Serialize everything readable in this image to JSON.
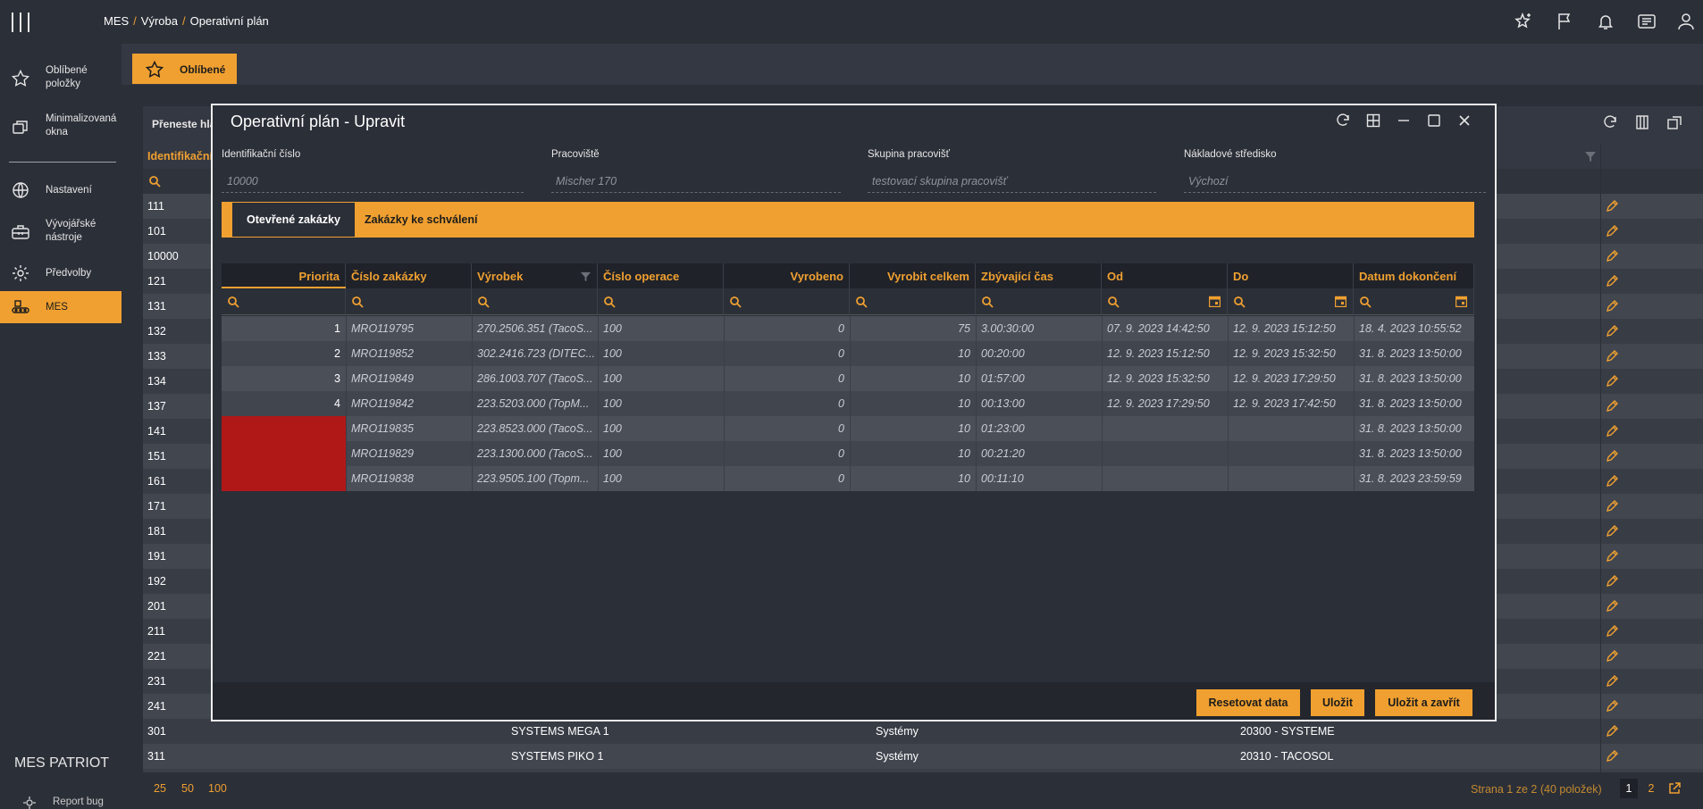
{
  "breadcrumb": {
    "part1": "MES",
    "part2": "Výroba",
    "part3": "Operativní plán"
  },
  "sidebar": {
    "items": [
      {
        "label": "Oblíbené položky",
        "icon": "star-icon"
      },
      {
        "label": "Minimalizovaná okna",
        "icon": "windows-icon"
      },
      {
        "label": "Nastavení",
        "icon": "globe-icon"
      },
      {
        "label": "Vývojářské nástroje",
        "icon": "toolbox-icon"
      },
      {
        "label": "Předvolby",
        "icon": "gear-icon"
      },
      {
        "label": "MES",
        "icon": "conveyor-icon"
      }
    ],
    "brand": "MES PATRIOT",
    "report_bug": "Report bug"
  },
  "favorites": {
    "label": "Oblíbené"
  },
  "background": {
    "toolbar_text": "Přeneste hla",
    "header_text": "Identifikační",
    "rows": [
      [
        "111",
        "",
        "",
        ""
      ],
      [
        "101",
        "",
        "",
        ""
      ],
      [
        "10000",
        "",
        "",
        ""
      ],
      [
        "121",
        "",
        "",
        ""
      ],
      [
        "131",
        "",
        "",
        ""
      ],
      [
        "132",
        "",
        "",
        ""
      ],
      [
        "133",
        "",
        "",
        ""
      ],
      [
        "134",
        "",
        "",
        ""
      ],
      [
        "137",
        "",
        "",
        ""
      ],
      [
        "141",
        "",
        "",
        ""
      ],
      [
        "151",
        "",
        "",
        ""
      ],
      [
        "161",
        "",
        "",
        ""
      ],
      [
        "171",
        "",
        "",
        ""
      ],
      [
        "181",
        "",
        "",
        ""
      ],
      [
        "191",
        "",
        "",
        ""
      ],
      [
        "192",
        "",
        "",
        ""
      ],
      [
        "201",
        "",
        "",
        ""
      ],
      [
        "211",
        "",
        "",
        ""
      ],
      [
        "221",
        "",
        "",
        ""
      ],
      [
        "231",
        "",
        "",
        ""
      ],
      [
        "241",
        "",
        "",
        ""
      ],
      [
        "301",
        "SYSTEMS MEGA 1",
        "Systémy",
        "20300 - SYSTEME"
      ],
      [
        "311",
        "SYSTEMS PIKO 1",
        "Systémy",
        "20310 - TACOSOL"
      ]
    ],
    "page_sizes": [
      "25",
      "50",
      "100"
    ],
    "page_info": "Strana 1 ze 2 (40 položek)",
    "pages": [
      "1",
      "2"
    ]
  },
  "modal": {
    "title": "Operativní plán - Upravit",
    "fields": [
      {
        "label": "Identifikační číslo",
        "value": "10000"
      },
      {
        "label": "Pracoviště",
        "value": "Mischer 170"
      },
      {
        "label": "Skupina pracovišť",
        "value": "testovací skupina pracovišť"
      },
      {
        "label": "Nákladové středisko",
        "value": "Výchozí"
      }
    ],
    "tabs": [
      "Otevřené zakázky",
      "Zakázky ke schválení"
    ],
    "columns": [
      "Priorita",
      "Číslo zakázky",
      "Výrobek",
      "Číslo operace",
      "Vyrobeno",
      "Vyrobit celkem",
      "Zbývající čas",
      "Od",
      "Do",
      "Datum dokončení"
    ],
    "rows": [
      [
        "1",
        "MRO119795",
        "270.2506.351 (TacoS...",
        "100",
        "0",
        "75",
        "3.00:30:00",
        "07. 9. 2023 14:42:50",
        "12. 9. 2023 15:12:50",
        "18. 4. 2023 10:55:52"
      ],
      [
        "2",
        "MRO119852",
        "302.2416.723 (DITEC...",
        "100",
        "0",
        "10",
        "00:20:00",
        "12. 9. 2023 15:12:50",
        "12. 9. 2023 15:32:50",
        "31. 8. 2023 13:50:00"
      ],
      [
        "3",
        "MRO119849",
        "286.1003.707 (TacoS...",
        "100",
        "0",
        "10",
        "01:57:00",
        "12. 9. 2023 15:32:50",
        "12. 9. 2023 17:29:50",
        "31. 8. 2023 13:50:00"
      ],
      [
        "4",
        "MRO119842",
        "223.5203.000 (TopM...",
        "100",
        "0",
        "10",
        "00:13:00",
        "12. 9. 2023 17:29:50",
        "12. 9. 2023 17:42:50",
        "31. 8. 2023 13:50:00"
      ],
      [
        "",
        "MRO119835",
        "223.8523.000 (TacoS...",
        "100",
        "0",
        "10",
        "01:23:00",
        "",
        "",
        "31. 8. 2023 13:50:00"
      ],
      [
        "",
        "MRO119829",
        "223.1300.000 (TacoS...",
        "100",
        "0",
        "10",
        "00:21:20",
        "",
        "",
        "31. 8. 2023 13:50:00"
      ],
      [
        "",
        "MRO119838",
        "223.9505.100 (Topm...",
        "100",
        "0",
        "10",
        "00:11:10",
        "",
        "",
        "31. 8. 2023 23:59:59"
      ]
    ],
    "buttons": {
      "reset": "Resetovat data",
      "save": "Uložit",
      "save_close": "Uložit a zavřít"
    }
  },
  "colors": {
    "accent": "#f0a030",
    "background": "#2b2f38",
    "danger": "#b01818"
  }
}
